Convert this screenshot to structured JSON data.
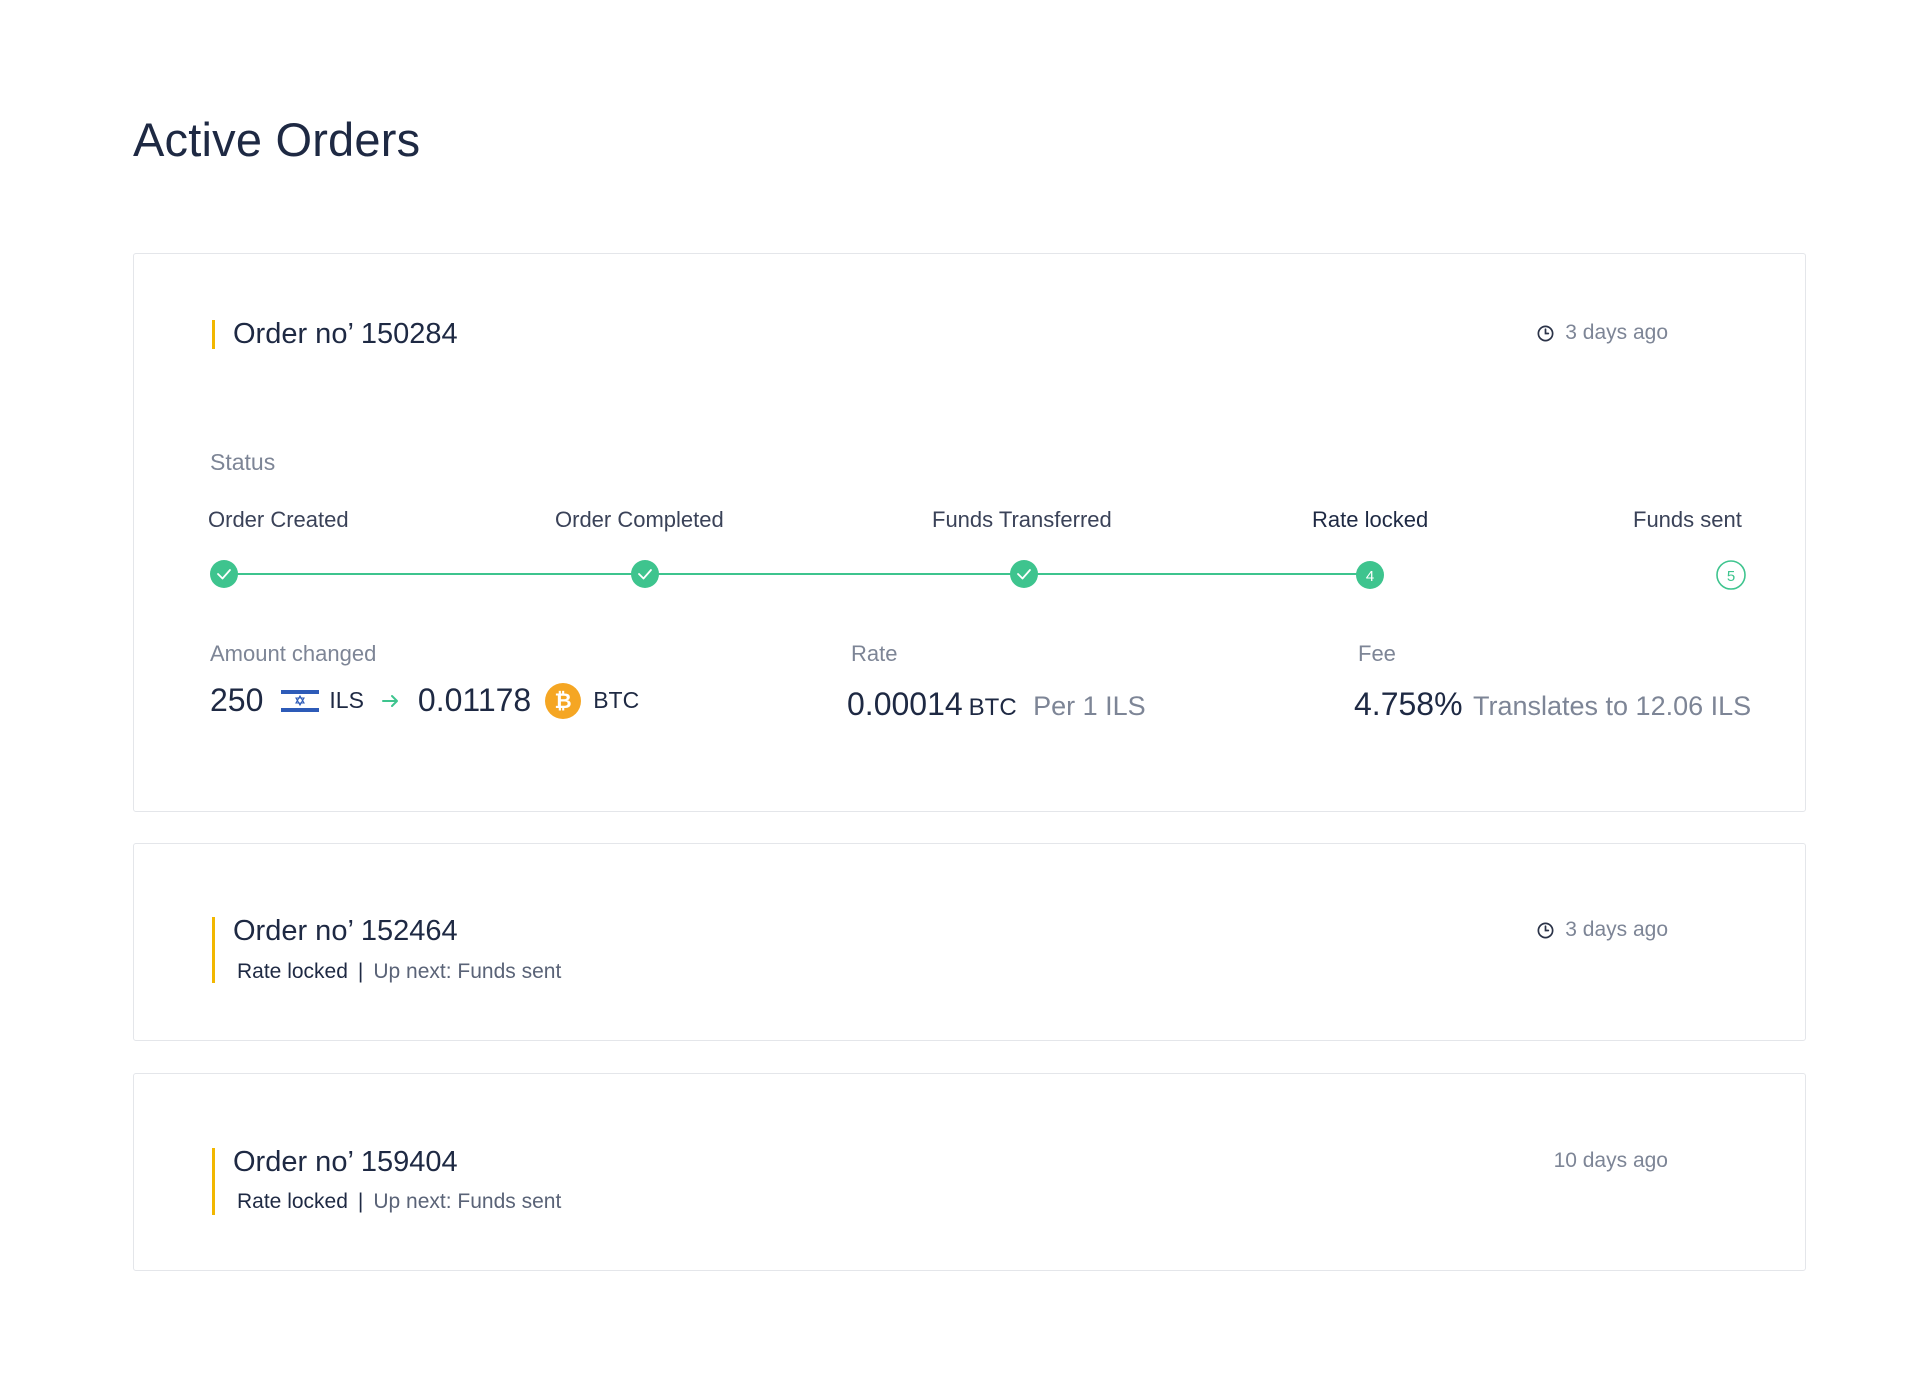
{
  "page": {
    "title": "Active Orders"
  },
  "colors": {
    "accent": "#f2b700",
    "progress_green": "#3ec48e",
    "text_primary": "#1e2943",
    "text_muted": "#7d8596",
    "btc_orange": "#f5a623"
  },
  "orders": [
    {
      "title": "Order no’ 150284",
      "time_ago": "3 days ago",
      "time_icon": "clock-icon",
      "status_label": "Status",
      "steps": [
        {
          "label": "Order Created",
          "state": "done",
          "marker": ""
        },
        {
          "label": "Order Completed",
          "state": "done",
          "marker": ""
        },
        {
          "label": "Funds Transferred",
          "state": "done",
          "marker": ""
        },
        {
          "label": "Rate locked",
          "state": "current",
          "marker": "4"
        },
        {
          "label": "Funds sent",
          "state": "pending",
          "marker": "5"
        }
      ],
      "amount": {
        "label": "Amount changed",
        "from_value": "250",
        "from_currency": "ILS",
        "from_icon": "israel-flag-icon",
        "to_value": "0.01178",
        "to_currency": "BTC",
        "to_icon": "bitcoin-icon",
        "to_icon_glyph": "₿"
      },
      "rate": {
        "label": "Rate",
        "value": "0.00014",
        "currency": "BTC",
        "per": "Per 1 ILS"
      },
      "fee": {
        "label": "Fee",
        "value": "4.758%",
        "note": "Translates to 12.06 ILS"
      }
    },
    {
      "title": "Order no’ 152464",
      "time_ago": "3 days ago",
      "time_icon": "clock-icon",
      "status": "Rate locked",
      "separator": "|",
      "next": "Up next: Funds sent"
    },
    {
      "title": "Order no’ 159404",
      "time_ago": "10 days ago",
      "status": "Rate locked",
      "separator": "|",
      "next": "Up next: Funds sent"
    }
  ]
}
